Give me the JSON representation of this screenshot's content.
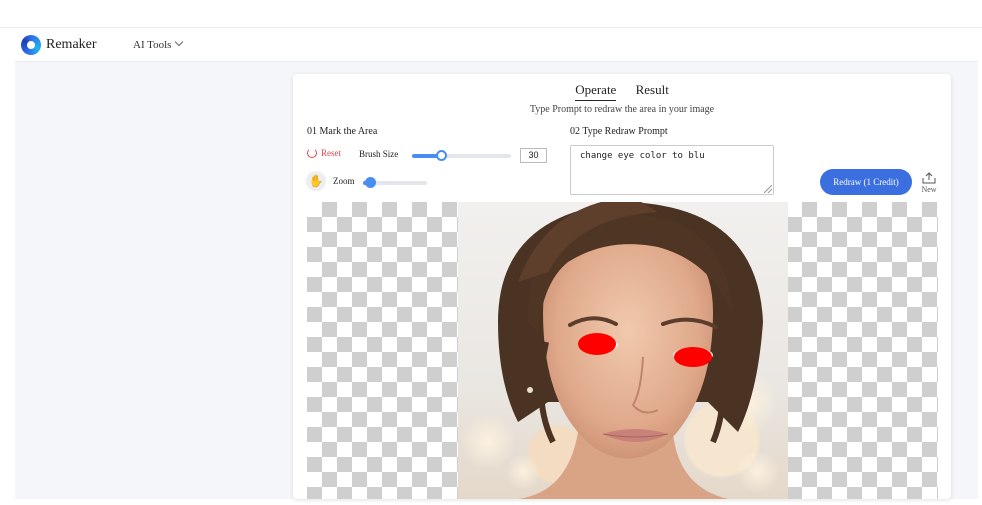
{
  "header": {
    "brand": "Remaker",
    "nav_tools_label": "AI Tools"
  },
  "tabs": [
    {
      "label": "Operate",
      "active": true
    },
    {
      "label": "Result",
      "active": false
    }
  ],
  "subtitle": "Type Prompt to redraw the area in your image",
  "mark_area": {
    "title": "01 Mark the Area",
    "reset_label": "Reset",
    "brush_size_label": "Brush Size",
    "brush_size_value": "30",
    "zoom_label": "Zoom"
  },
  "prompt_section": {
    "title": "02 Type Redraw Prompt",
    "prompt_value": "change eye color to blu"
  },
  "actions": {
    "redraw_label": "Redraw (1 Credit)",
    "new_label": "New"
  },
  "colors": {
    "accent": "#3b6fe0",
    "reset": "#e0454a",
    "mask": "#ff0000"
  },
  "icons": {
    "logo": "remaker-logo-icon",
    "reset": "refresh-icon",
    "hand": "hand-icon",
    "new": "upload-icon"
  }
}
